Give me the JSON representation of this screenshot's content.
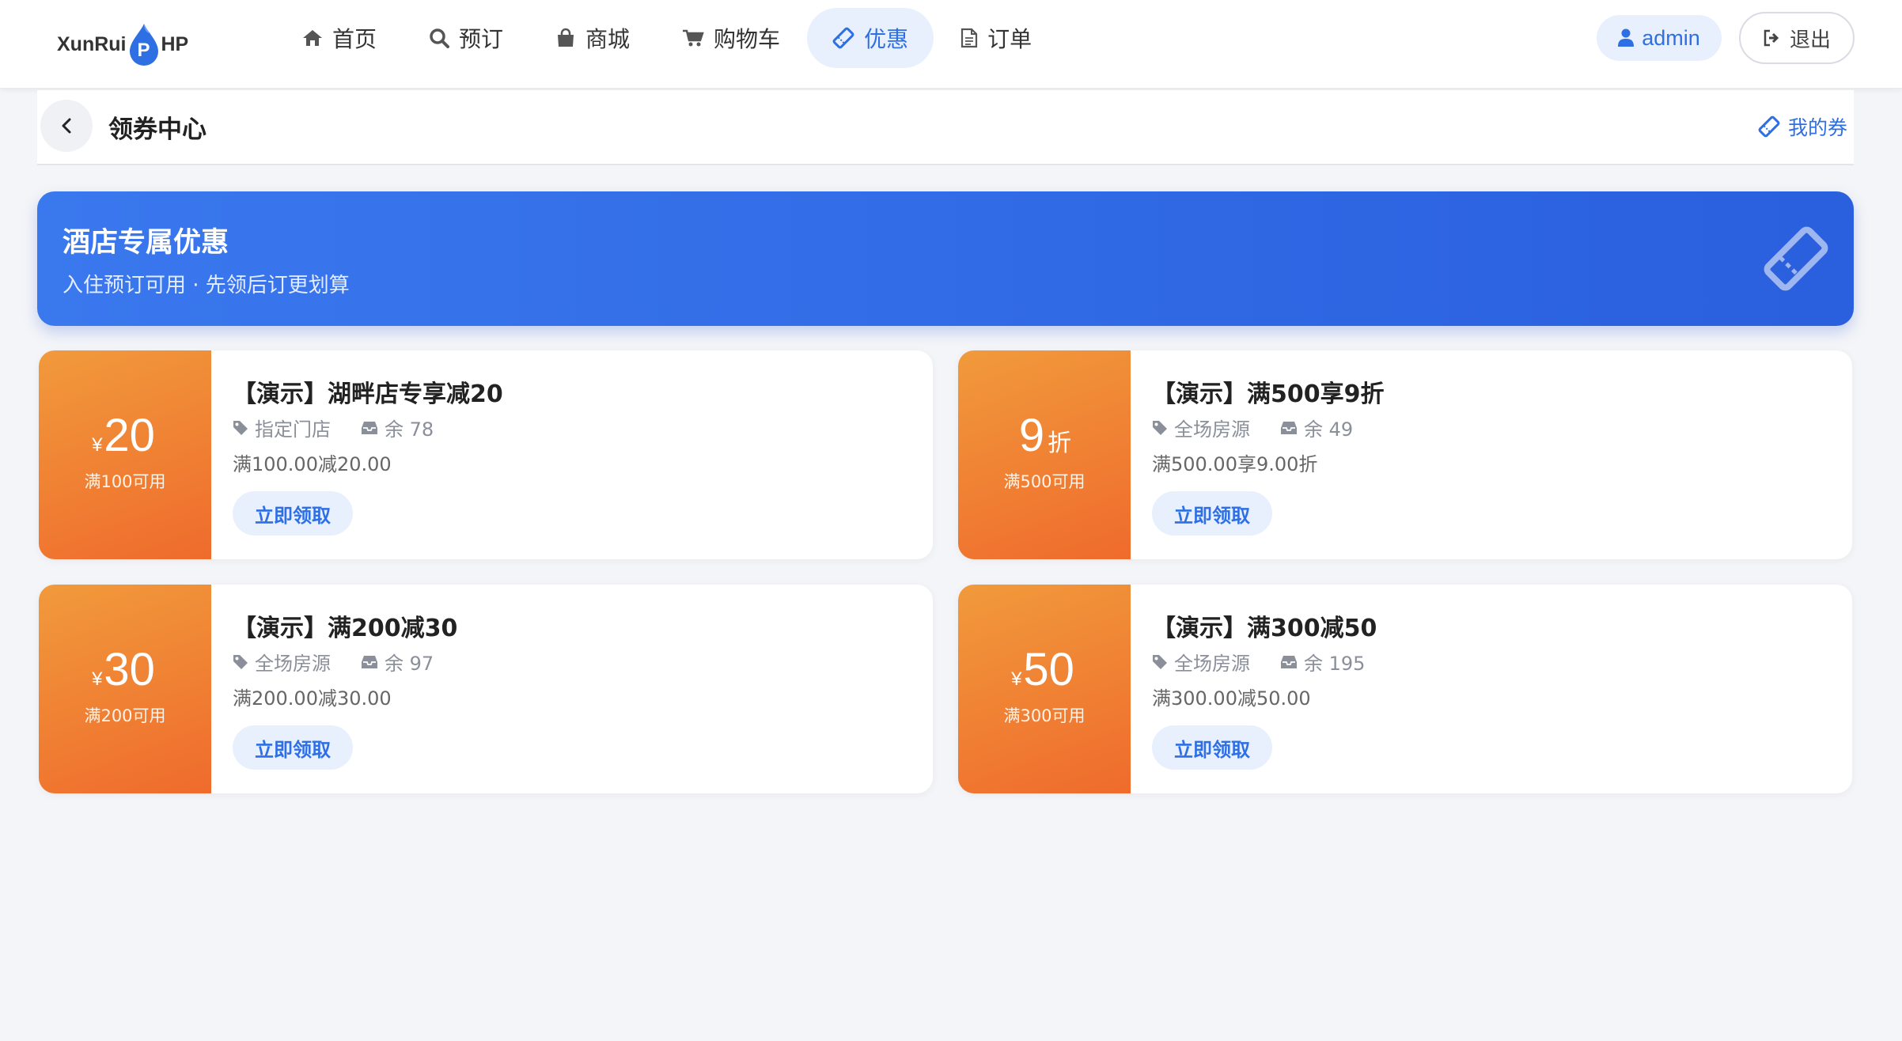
{
  "brand": {
    "left_text": "XunRui",
    "drop_letter": "P",
    "right_text": "HP"
  },
  "nav": [
    {
      "label": "首页",
      "icon": "home-icon"
    },
    {
      "label": "预订",
      "icon": "search-icon"
    },
    {
      "label": "商城",
      "icon": "bag-icon"
    },
    {
      "label": "购物车",
      "icon": "cart-icon"
    },
    {
      "label": "优惠",
      "icon": "ticket-icon",
      "active": true
    },
    {
      "label": "订单",
      "icon": "document-icon"
    }
  ],
  "user": {
    "name": "admin",
    "logout_label": "退出"
  },
  "subheader": {
    "title": "领券中心",
    "my_coupons_label": "我的券"
  },
  "banner": {
    "title": "酒店专属优惠",
    "subtitle": "入住预订可用 · 先领后订更划算"
  },
  "coupons": [
    {
      "currency": "¥",
      "amount": "20",
      "unit": "",
      "condition": "满100可用",
      "name": "【演示】湖畔店专享减20",
      "scope": "指定门店",
      "stock": "余 78",
      "rule": "满100.00减20.00",
      "claim_label": "立即领取"
    },
    {
      "currency": "",
      "amount": "9",
      "unit": "折",
      "condition": "满500可用",
      "name": "【演示】满500享9折",
      "scope": "全场房源",
      "stock": "余 49",
      "rule": "满500.00享9.00折",
      "claim_label": "立即领取"
    },
    {
      "currency": "¥",
      "amount": "30",
      "unit": "",
      "condition": "满200可用",
      "name": "【演示】满200减30",
      "scope": "全场房源",
      "stock": "余 97",
      "rule": "满200.00减30.00",
      "claim_label": "立即领取"
    },
    {
      "currency": "¥",
      "amount": "50",
      "unit": "",
      "condition": "满300可用",
      "name": "【演示】满300减50",
      "scope": "全场房源",
      "stock": "余 195",
      "rule": "满300.00减50.00",
      "claim_label": "立即领取"
    }
  ],
  "colors": {
    "accent": "#2f6fe4",
    "accent_soft": "#e8f0fd",
    "coupon_orange": "#ef7a2e",
    "banner_blue": "#3370e8"
  }
}
